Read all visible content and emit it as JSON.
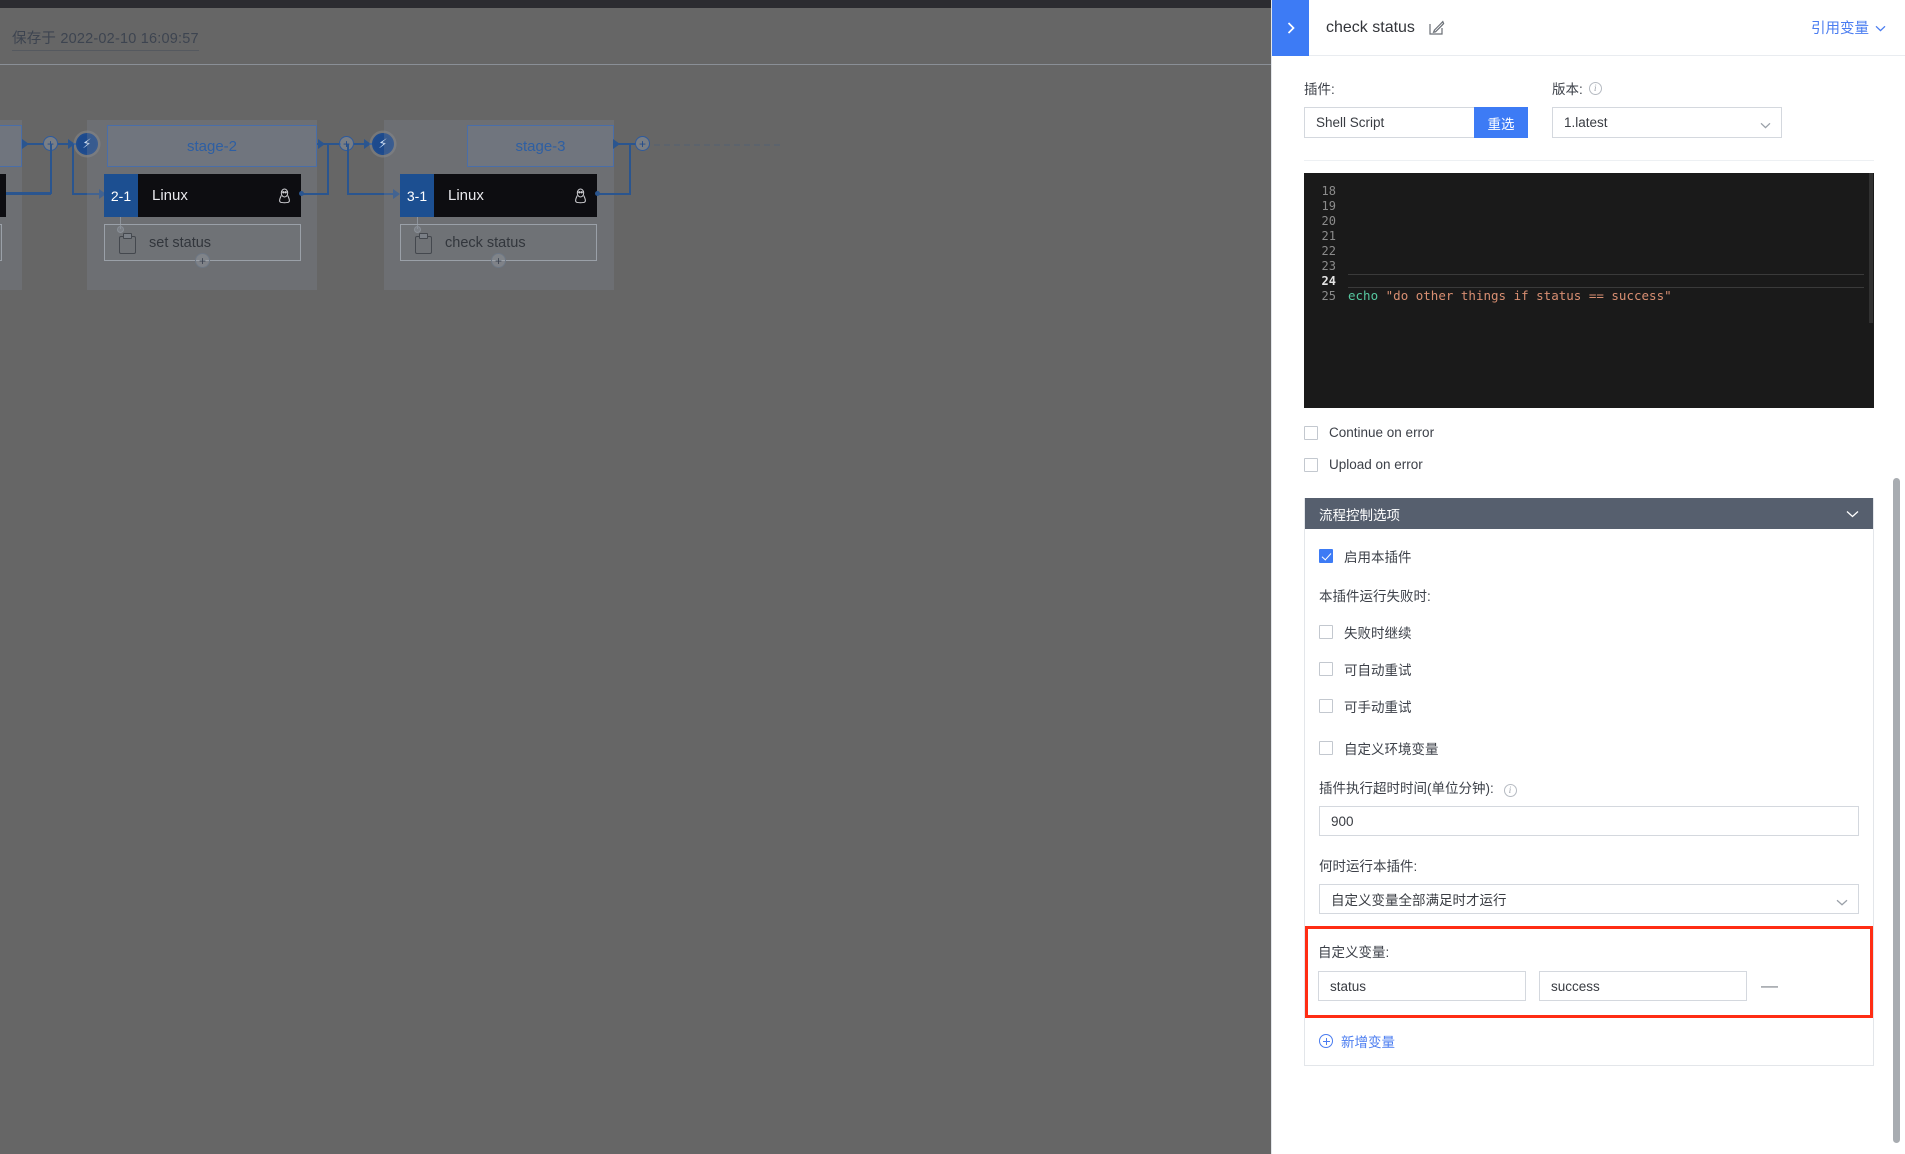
{
  "pipeline": {
    "saved_label": "保存于 2022-02-10 16:09:57",
    "stages": [
      {
        "name": "stage-2",
        "job": {
          "index": "2-1",
          "name": "Linux",
          "os_icon": "linux-penguin-icon"
        },
        "task": {
          "label": "set status",
          "icon": "clipboard-icon"
        }
      },
      {
        "name": "stage-3",
        "job": {
          "index": "3-1",
          "name": "Linux",
          "os_icon": "linux-penguin-icon"
        },
        "task": {
          "label": "check status",
          "icon": "clipboard-icon"
        }
      }
    ],
    "add_stage_label": "+",
    "trigger_icon": "bolt-icon"
  },
  "panel": {
    "collapse_icon": "chevron-right-icon",
    "title": "check status",
    "edit_icon": "edit-pencil-icon",
    "ref_var_label": "引用变量",
    "ref_var_chevron": "chevron-down-icon",
    "plugin": {
      "label": "插件:",
      "value": "Shell Script",
      "placeholder": "Shell Script",
      "reselect_label": "重选"
    },
    "version": {
      "label": "版本:",
      "info_icon": "info-icon",
      "value": "1.latest",
      "chevron": "chevron-down-icon"
    },
    "editor": {
      "lines": [
        {
          "no": "18",
          "text": "",
          "active": false
        },
        {
          "no": "19",
          "text": "",
          "active": false
        },
        {
          "no": "20",
          "text": "",
          "active": false
        },
        {
          "no": "21",
          "text": "",
          "active": false
        },
        {
          "no": "22",
          "text": "",
          "active": false
        },
        {
          "no": "23",
          "text": "",
          "active": false
        },
        {
          "no": "24",
          "text": "",
          "active": true
        },
        {
          "no": "25",
          "text": "echo \"do other things if status == success\"",
          "active": false
        }
      ],
      "line25_cmd": "echo ",
      "line25_str": "\"do other things if status == success\"",
      "colors": {
        "background": "#1a1a1a",
        "command": "#56c8a0",
        "string": "#d98f72",
        "line_number": "#8b8b8b"
      }
    },
    "options": [
      {
        "label": "Continue on error",
        "checked": false
      },
      {
        "label": "Upload on error",
        "checked": false
      }
    ],
    "flow_control": {
      "header": "流程控制选项",
      "chevron": "chevron-down-icon",
      "enable_plugin": {
        "label": "启用本插件",
        "checked": true
      },
      "on_failure_label": "本插件运行失败时:",
      "failure_options": [
        {
          "label": "失败时继续",
          "checked": false
        },
        {
          "label": "可自动重试",
          "checked": false
        },
        {
          "label": "可手动重试",
          "checked": false
        }
      ],
      "custom_env": {
        "label": "自定义环境变量",
        "checked": false
      },
      "timeout": {
        "label": "插件执行超时时间(单位分钟):",
        "info_icon": "info-icon",
        "value": "900"
      },
      "when_run": {
        "label": "何时运行本插件:",
        "value": "自定义变量全部满足时才运行",
        "chevron": "chevron-down-icon"
      },
      "custom_vars": {
        "label": "自定义变量:",
        "highlight_color": "#ff2d14",
        "rows": [
          {
            "key": "status",
            "value": "success",
            "remove_icon": "minus-icon"
          }
        ],
        "add_label": "新增变量",
        "add_icon": "plus-circle-icon"
      }
    }
  },
  "colors": {
    "accent_blue": "#3d7bf5",
    "link_blue": "#4a7cf0",
    "node_dark": "#0d0d11",
    "node_index_blue": "#1c4f91",
    "flow_header_gray": "#565f6e",
    "highlight_red": "#ff2d14"
  }
}
